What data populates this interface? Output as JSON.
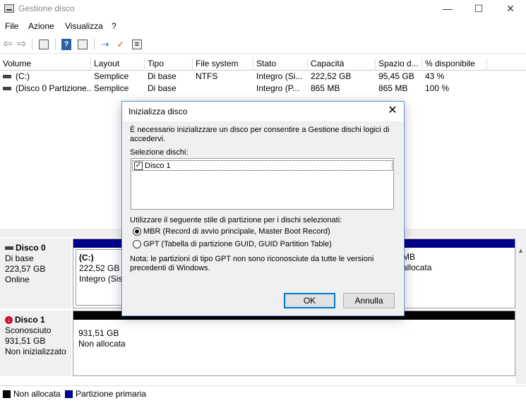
{
  "window": {
    "title": "Gestione disco",
    "minimize": "—",
    "maximize": "☐",
    "close": "✕"
  },
  "menu": [
    "File",
    "Azione",
    "Visualizza",
    "?"
  ],
  "toolbar": {
    "icons": [
      "back-icon",
      "forward-icon",
      "console-tree-icon",
      "help-icon",
      "properties-icon",
      "connect-icon",
      "check-icon",
      "rescan-icon"
    ],
    "back": "⇦",
    "forward": "⇨",
    "help": "?",
    "connect": "⇢",
    "check": "✓",
    "rescan": "≡"
  },
  "volume_table": {
    "columns": [
      "Volume",
      "Layout",
      "Tipo",
      "File system",
      "Stato",
      "Capacità",
      "Spazio d...",
      "% disponibile"
    ],
    "rows": [
      [
        "(C:)",
        "Semplice",
        "Di base",
        "NTFS",
        "Integro (Si...",
        "222,52 GB",
        "95,45 GB",
        "43 %"
      ],
      [
        "(Disco 0 Partizione...",
        "Semplice",
        "Di base",
        "",
        "Integro (P...",
        "865 MB",
        "865 MB",
        "100 %"
      ]
    ]
  },
  "disks": [
    {
      "name": "Disco 0",
      "type": "Di base",
      "size": "223,57 GB",
      "status": "Online",
      "partitions": [
        {
          "line1": "(C:)",
          "line2": "222,52 GB N",
          "line3": "Integro (Sist"
        },
        {
          "line1": "",
          "line2": "MB",
          "line3": "allocata"
        }
      ]
    },
    {
      "name": "Disco 1",
      "type": "Sconosciuto",
      "size": "931,51 GB",
      "status": "Non inizializzato",
      "partitions": [
        {
          "line1": "",
          "line2": "931,51 GB",
          "line3": "Non allocata"
        }
      ]
    }
  ],
  "legend": [
    {
      "label": "Non allocata",
      "color": "#000000"
    },
    {
      "label": "Partizione primaria",
      "color": "#00008b"
    }
  ],
  "colors": {
    "primary_partition": "#00008b",
    "unallocated": "#000000",
    "accent": "#0078d7"
  },
  "dialog": {
    "title": "Inizializza disco",
    "close": "✕",
    "intro_line1": "È necessario inizializzare un disco per consentire a Gestione dischi logici di",
    "intro_line2": "accedervi.",
    "select_label": "Selezione dischi:",
    "disk_item": "Disco 1",
    "disk_checked": "✓",
    "style_label": "Utilizzare il seguente stile di partizione per i dischi selezionati:",
    "mbr_option": "MBR (Record di avvio principale, Master Boot Record)",
    "gpt_option": "GPT (Tabella di partizione GUID, GUID Partition Table)",
    "selected_style": "MBR",
    "note_line1": "Nota: le partizioni di tipo GPT non sono riconosciute da tutte le versioni",
    "note_line2": "precedenti di Windows.",
    "ok_label": "OK",
    "cancel_label": "Annulla"
  }
}
